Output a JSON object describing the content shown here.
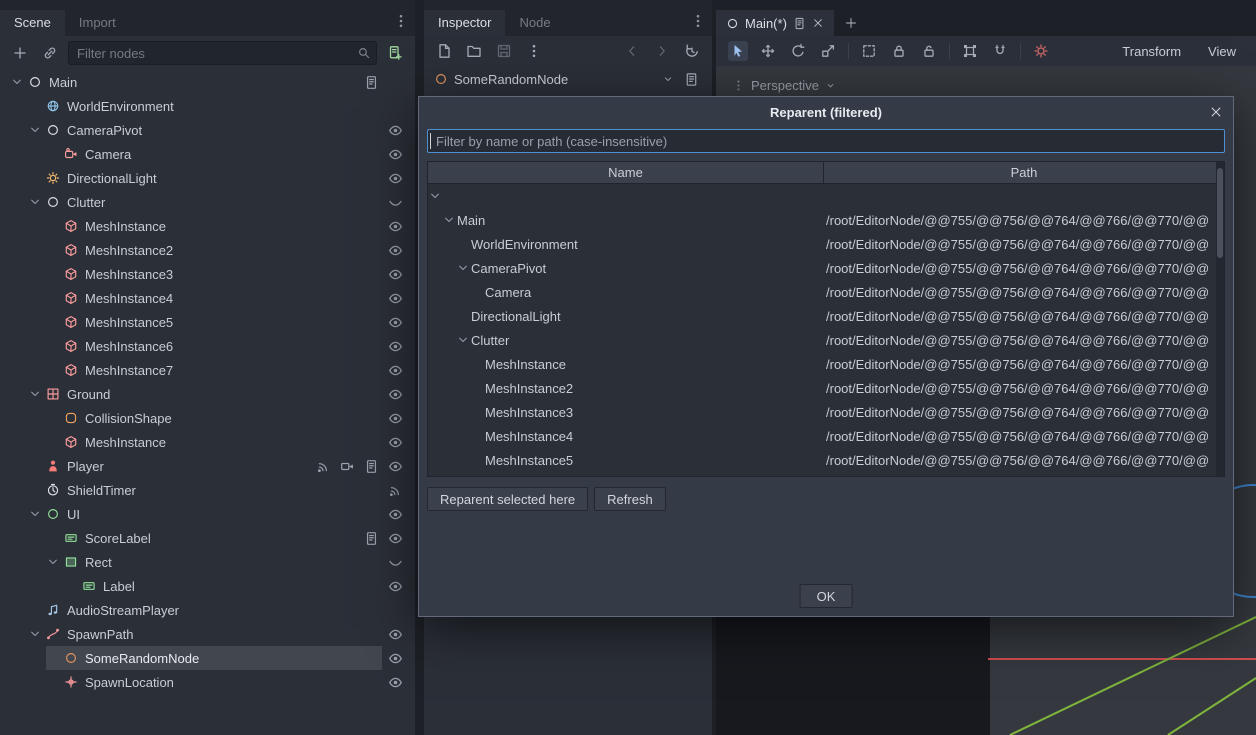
{
  "scene_dock": {
    "tabs": [
      {
        "label": "Scene",
        "active": true
      },
      {
        "label": "Import",
        "active": false
      }
    ],
    "toolbar": {
      "left": [
        {
          "name": "add-node",
          "icon": "plus"
        },
        {
          "name": "instance-scene",
          "icon": "link"
        }
      ],
      "filter_placeholder": "Filter nodes",
      "right": [
        {
          "name": "attach-script",
          "icon": "script-plus",
          "color": "#9fd79f"
        }
      ]
    },
    "tree": [
      {
        "label": "Main",
        "depth": 0,
        "icon": "node-circle",
        "color": "#e3e5e9",
        "expand": true,
        "right": [
          "script",
          "blank"
        ]
      },
      {
        "label": "WorldEnvironment",
        "depth": 1,
        "icon": "world",
        "color": "#8fc3e8",
        "right": []
      },
      {
        "label": "CameraPivot",
        "depth": 1,
        "icon": "node-circle",
        "color": "#e3e5e9",
        "expand": true,
        "right": [
          "eye"
        ]
      },
      {
        "label": "Camera",
        "depth": 2,
        "icon": "camera",
        "color": "#fc9c9c",
        "right": [
          "eye"
        ]
      },
      {
        "label": "DirectionalLight",
        "depth": 1,
        "icon": "sun",
        "color": "#f8bb6d",
        "right": [
          "eye"
        ]
      },
      {
        "label": "Clutter",
        "depth": 1,
        "icon": "node-circle",
        "color": "#e3e5e9",
        "expand": true,
        "right": [
          "eye-closed"
        ]
      },
      {
        "label": "MeshInstance",
        "depth": 2,
        "icon": "mesh",
        "color": "#fc9c9c",
        "right": [
          "eye"
        ]
      },
      {
        "label": "MeshInstance2",
        "depth": 2,
        "icon": "mesh",
        "color": "#fc9c9c",
        "right": [
          "eye"
        ]
      },
      {
        "label": "MeshInstance3",
        "depth": 2,
        "icon": "mesh",
        "color": "#fc9c9c",
        "right": [
          "eye"
        ]
      },
      {
        "label": "MeshInstance4",
        "depth": 2,
        "icon": "mesh",
        "color": "#fc9c9c",
        "right": [
          "eye"
        ]
      },
      {
        "label": "MeshInstance5",
        "depth": 2,
        "icon": "mesh",
        "color": "#fc9c9c",
        "right": [
          "eye"
        ]
      },
      {
        "label": "MeshInstance6",
        "depth": 2,
        "icon": "mesh",
        "color": "#fc9c9c",
        "right": [
          "eye"
        ]
      },
      {
        "label": "MeshInstance7",
        "depth": 2,
        "icon": "mesh",
        "color": "#fc9c9c",
        "right": [
          "eye"
        ]
      },
      {
        "label": "Ground",
        "depth": 1,
        "icon": "ground",
        "color": "#fc9c9c",
        "expand": true,
        "right": [
          "eye"
        ]
      },
      {
        "label": "CollisionShape",
        "depth": 2,
        "icon": "collision",
        "color": "#f0a35e",
        "right": [
          "eye"
        ]
      },
      {
        "label": "MeshInstance",
        "depth": 2,
        "icon": "mesh",
        "color": "#fc9c9c",
        "right": [
          "eye"
        ]
      },
      {
        "label": "Player",
        "depth": 1,
        "icon": "person",
        "color": "#fc7b7b",
        "right": [
          "signal",
          "groups",
          "script",
          "eye"
        ]
      },
      {
        "label": "ShieldTimer",
        "depth": 1,
        "icon": "timer",
        "color": "#e3e5e9",
        "right": [
          "signal"
        ]
      },
      {
        "label": "UI",
        "depth": 1,
        "icon": "node-circle",
        "color": "#93e29b",
        "expand": true,
        "right": [
          "eye"
        ]
      },
      {
        "label": "ScoreLabel",
        "depth": 2,
        "icon": "label",
        "color": "#93e29b",
        "right": [
          "script",
          "eye"
        ]
      },
      {
        "label": "Rect",
        "depth": 2,
        "icon": "rect-node",
        "color": "#93e29b",
        "expand": true,
        "right": [
          "eye-closed"
        ]
      },
      {
        "label": "Label",
        "depth": 3,
        "icon": "label",
        "color": "#93e29b",
        "right": [
          "eye"
        ]
      },
      {
        "label": "AudioStreamPlayer",
        "depth": 1,
        "icon": "audio",
        "color": "#a9c8e8",
        "right": []
      },
      {
        "label": "SpawnPath",
        "depth": 1,
        "icon": "path",
        "color": "#fc9c9c",
        "expand": true,
        "right": [
          "eye"
        ]
      },
      {
        "label": "SomeRandomNode",
        "depth": 2,
        "icon": "node-circle",
        "color": "#eb9862",
        "selected": true,
        "right": [
          "eye"
        ]
      },
      {
        "label": "SpawnLocation",
        "depth": 2,
        "icon": "position",
        "color": "#fc9c9c",
        "right": [
          "eye"
        ]
      }
    ]
  },
  "inspector_dock": {
    "tabs": [
      {
        "label": "Inspector",
        "active": true
      },
      {
        "label": "Node",
        "active": false
      }
    ],
    "toolbar": {
      "left": [
        {
          "name": "new-resource",
          "icon": "new-resource"
        },
        {
          "name": "load-resource",
          "icon": "folder"
        },
        {
          "name": "save-resource",
          "icon": "save",
          "dim": true
        },
        {
          "name": "resource-options",
          "icon": "dots"
        }
      ],
      "right": [
        {
          "name": "history-back",
          "icon": "chev-left",
          "dim": true
        },
        {
          "name": "history-forward",
          "icon": "chev-right",
          "dim": true
        },
        {
          "name": "object-history",
          "icon": "history"
        }
      ]
    },
    "node_selector": {
      "value": "SomeRandomNode",
      "icon": "node-circle",
      "color": "#eb9862"
    }
  },
  "viewport": {
    "scene_tab": {
      "label": "Main(*)"
    },
    "tools": [
      {
        "name": "select-tool",
        "icon": "cursor",
        "color": "#9ec2f0",
        "active": true
      },
      {
        "name": "move-tool",
        "icon": "move"
      },
      {
        "name": "rotate-tool",
        "icon": "rotate"
      },
      {
        "name": "scale-tool",
        "icon": "scale"
      },
      {
        "sep": true
      },
      {
        "name": "list-select-tool",
        "icon": "box-select"
      },
      {
        "name": "lock-selected",
        "icon": "lock"
      },
      {
        "name": "unlock-selected",
        "icon": "unlock"
      },
      {
        "sep": true
      },
      {
        "name": "group-selected",
        "icon": "group"
      },
      {
        "name": "snap-toggle",
        "icon": "snap"
      },
      {
        "sep": true
      },
      {
        "name": "environment-toggle",
        "icon": "environment",
        "color": "#d06a6a"
      }
    ],
    "menus": [
      {
        "label": "Transform"
      },
      {
        "label": "View"
      }
    ],
    "perspective_label": "Perspective"
  },
  "dialog": {
    "title": "Reparent (filtered)",
    "filter_placeholder": "Filter by name or path (case-insensitive)",
    "columns": [
      "Name",
      "Path"
    ],
    "rows": [
      {
        "name": "",
        "depth": 0,
        "expand": true,
        "path": ""
      },
      {
        "name": "Main",
        "depth": 1,
        "expand": true,
        "path": "/root/EditorNode/@@755/@@756/@@764/@@766/@@770/@@"
      },
      {
        "name": "WorldEnvironment",
        "depth": 2,
        "path": "/root/EditorNode/@@755/@@756/@@764/@@766/@@770/@@"
      },
      {
        "name": "CameraPivot",
        "depth": 2,
        "expand": true,
        "path": "/root/EditorNode/@@755/@@756/@@764/@@766/@@770/@@"
      },
      {
        "name": "Camera",
        "depth": 3,
        "path": "/root/EditorNode/@@755/@@756/@@764/@@766/@@770/@@"
      },
      {
        "name": "DirectionalLight",
        "depth": 2,
        "path": "/root/EditorNode/@@755/@@756/@@764/@@766/@@770/@@"
      },
      {
        "name": "Clutter",
        "depth": 2,
        "expand": true,
        "path": "/root/EditorNode/@@755/@@756/@@764/@@766/@@770/@@"
      },
      {
        "name": "MeshInstance",
        "depth": 3,
        "path": "/root/EditorNode/@@755/@@756/@@764/@@766/@@770/@@"
      },
      {
        "name": "MeshInstance2",
        "depth": 3,
        "path": "/root/EditorNode/@@755/@@756/@@764/@@766/@@770/@@"
      },
      {
        "name": "MeshInstance3",
        "depth": 3,
        "path": "/root/EditorNode/@@755/@@756/@@764/@@766/@@770/@@"
      },
      {
        "name": "MeshInstance4",
        "depth": 3,
        "path": "/root/EditorNode/@@755/@@756/@@764/@@766/@@770/@@"
      },
      {
        "name": "MeshInstance5",
        "depth": 3,
        "path": "/root/EditorNode/@@755/@@756/@@764/@@766/@@770/@@"
      }
    ],
    "buttons": {
      "reparent": "Reparent selected here",
      "refresh": "Refresh",
      "ok": "OK"
    }
  },
  "colors": {
    "accent": "#4f8fd2",
    "selection": "#41464f",
    "salmon": "#fc9c9c",
    "green": "#93e29b",
    "panel": "#2b2f38"
  }
}
